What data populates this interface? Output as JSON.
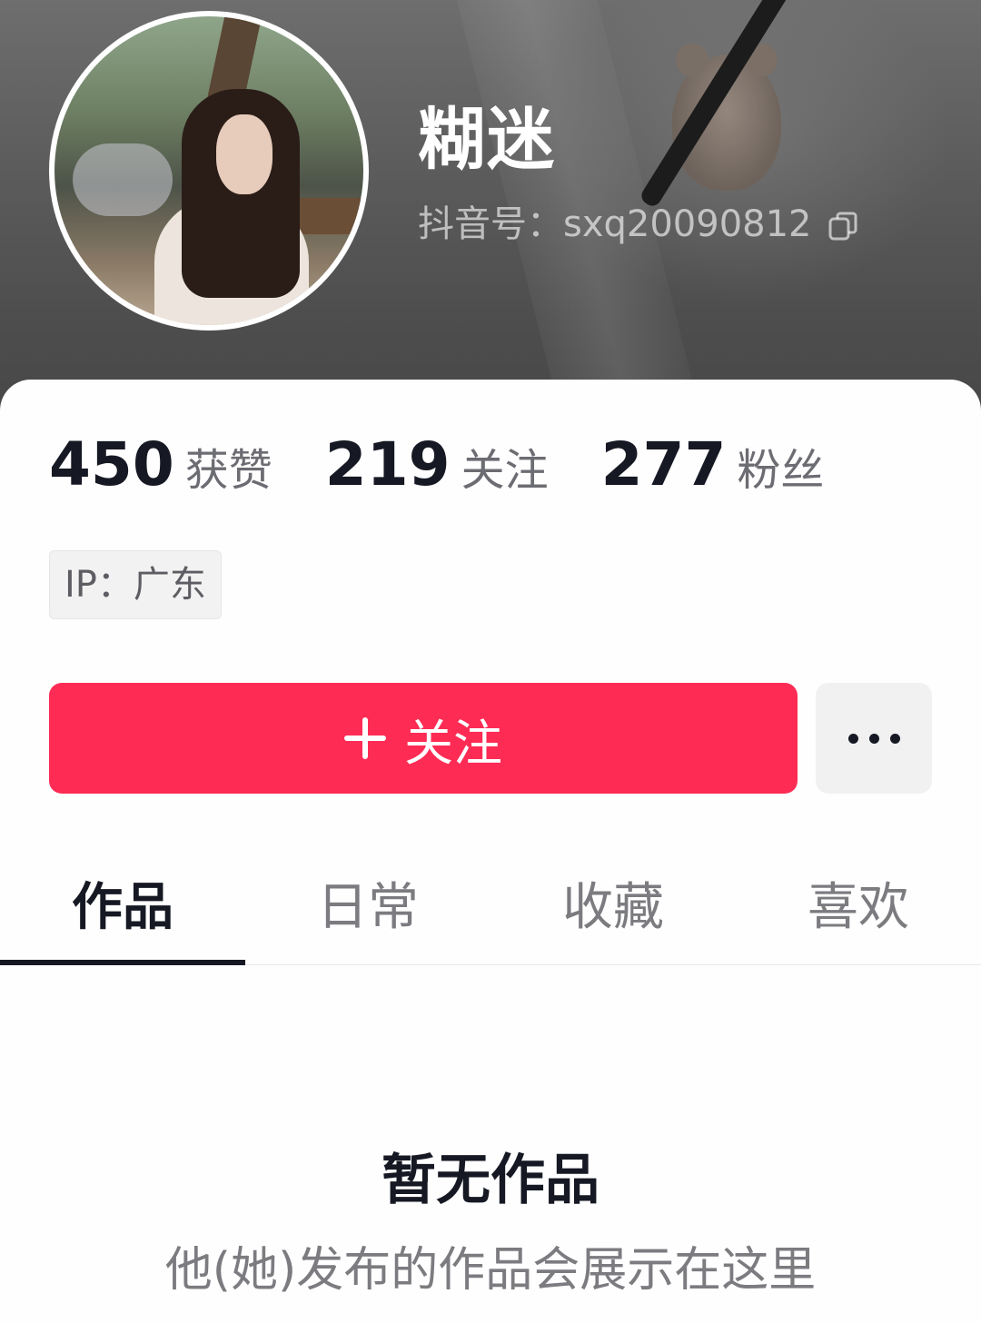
{
  "profile": {
    "nickname": "糊迷",
    "douyin_id_label": "抖音号：sxq20090812",
    "avatar_icon": "avatar-photo"
  },
  "stats": [
    {
      "value": "450",
      "label": "获赞"
    },
    {
      "value": "219",
      "label": "关注"
    },
    {
      "value": "277",
      "label": "粉丝"
    }
  ],
  "ip": {
    "label": "IP：广东"
  },
  "actions": {
    "follow_label": "关注",
    "follow_color": "#fe2c55",
    "more_icon": "more-icon"
  },
  "tabs": [
    {
      "label": "作品",
      "active": true
    },
    {
      "label": "日常",
      "active": false
    },
    {
      "label": "收藏",
      "active": false
    },
    {
      "label": "喜欢",
      "active": false
    }
  ],
  "empty_state": {
    "title": "暂无作品",
    "description": "他(她)发布的作品会展示在这里"
  }
}
